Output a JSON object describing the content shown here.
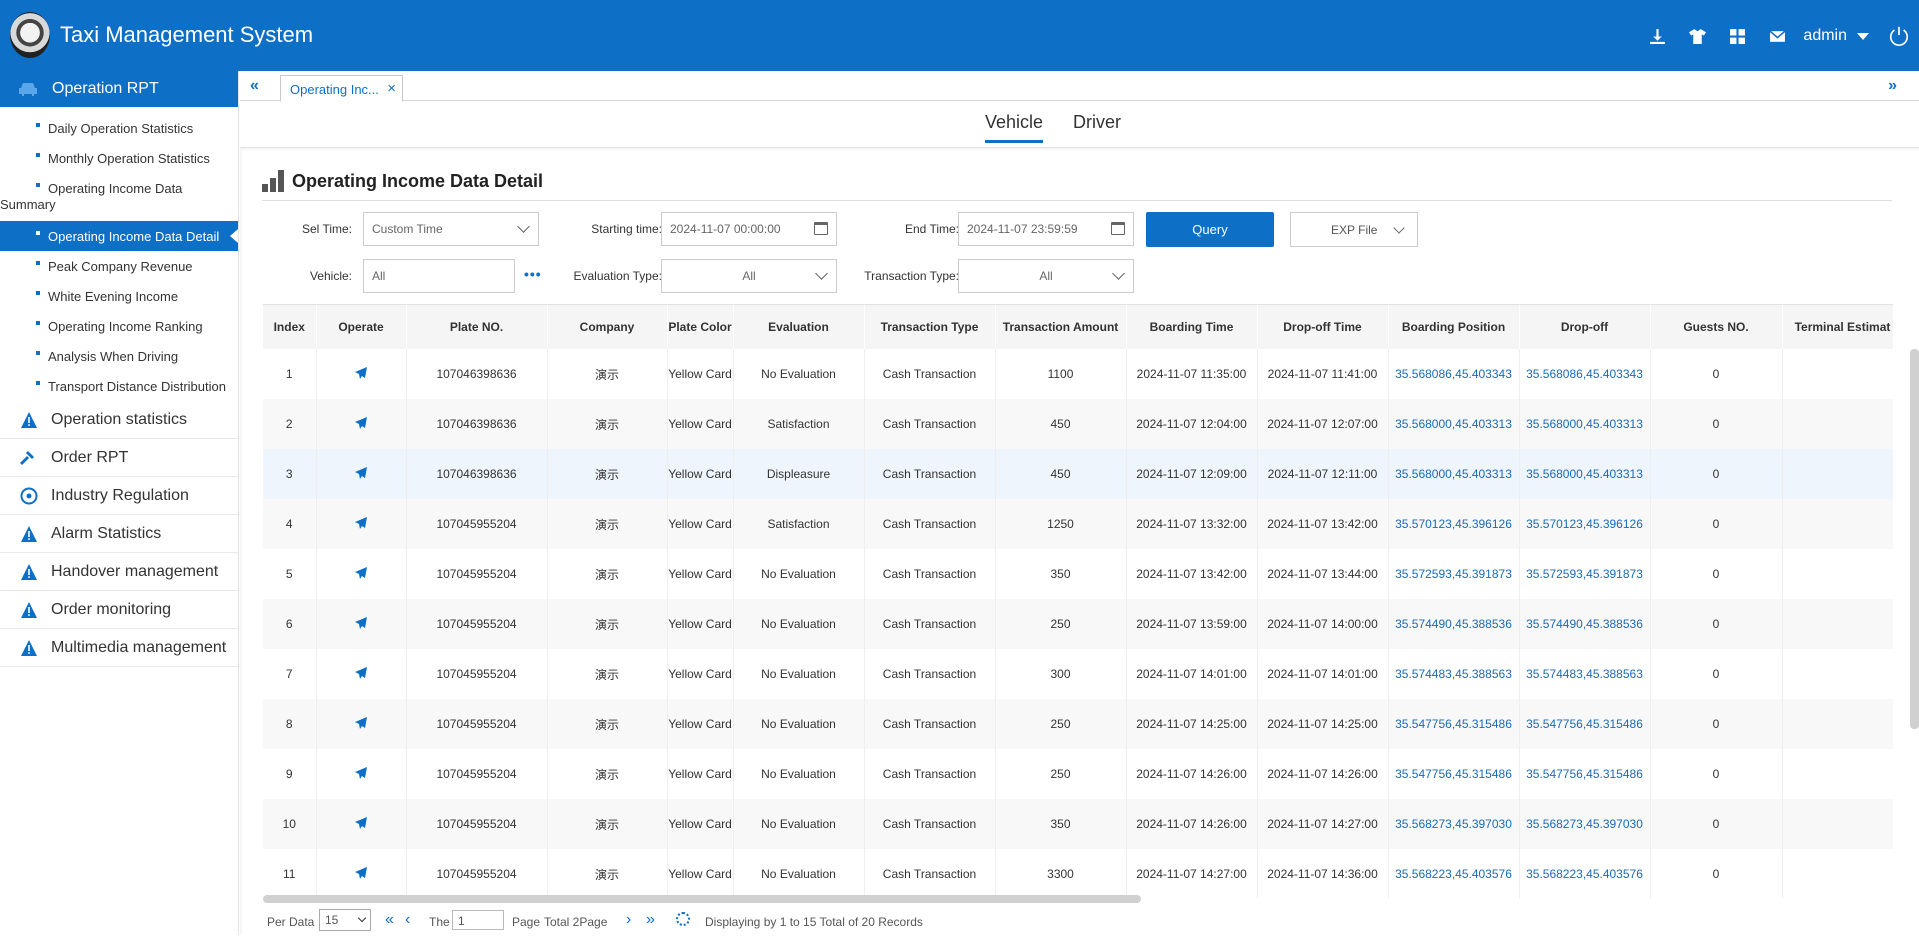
{
  "header": {
    "title": "Taxi Management System",
    "user": "admin",
    "icons": [
      "download-icon",
      "shirt-icon",
      "grid-icon",
      "mail-icon"
    ]
  },
  "sidebar": {
    "active_group": "Operation RPT",
    "subitems": [
      "Daily Operation Statistics",
      "Monthly Operation Statistics",
      "Operating Income Data",
      "Summary",
      "Operating Income Data Detail",
      "Peak Company Revenue",
      "White Evening Income",
      "Operating Income Ranking",
      "Analysis When Driving",
      "Transport Distance Distribution"
    ],
    "groups": [
      "Operation statistics",
      "Order RPT",
      "Industry Regulation",
      "Alarm Statistics",
      "Handover management",
      "Order monitoring",
      "Multimedia management"
    ]
  },
  "tabs": {
    "open_tab": "Operating Inc...",
    "close": "×",
    "collapse_left": "«",
    "collapse_right": "»"
  },
  "subnav": {
    "vehicle": "Vehicle",
    "driver": "Driver"
  },
  "section": {
    "title": "Operating Income Data Detail"
  },
  "filters": {
    "sel_time_label": "Sel Time:",
    "sel_time_value": "Custom Time",
    "start_label": "Starting time:",
    "start_value": "2024-11-07 00:00:00",
    "end_label": "End Time:",
    "end_value": "2024-11-07 23:59:59",
    "query": "Query",
    "export": "EXP File",
    "vehicle_label": "Vehicle:",
    "vehicle_value": "All",
    "more": "•••",
    "eval_label": "Evaluation Type:",
    "eval_value": "All",
    "trans_label": "Transaction Type:",
    "trans_value": "All"
  },
  "table": {
    "columns": [
      "Index",
      "Operate",
      "Plate NO.",
      "Company",
      "Plate Color",
      "Evaluation",
      "Transaction Type",
      "Transaction Amount",
      "Boarding Time",
      "Drop-off Time",
      "Boarding Position",
      "Drop-off",
      "Guests NO.",
      "Terminal Estimat"
    ],
    "rows": [
      [
        "1",
        "107046398636",
        "演示",
        "Yellow Card",
        "No Evaluation",
        "Cash Transaction",
        "1100",
        "2024-11-07 11:35:00",
        "2024-11-07 11:41:00",
        "35.568086,45.403343",
        "35.568086,45.403343",
        "0"
      ],
      [
        "2",
        "107046398636",
        "演示",
        "Yellow Card",
        "Satisfaction",
        "Cash Transaction",
        "450",
        "2024-11-07 12:04:00",
        "2024-11-07 12:07:00",
        "35.568000,45.403313",
        "35.568000,45.403313",
        "0"
      ],
      [
        "3",
        "107046398636",
        "演示",
        "Yellow Card",
        "Displeasure",
        "Cash Transaction",
        "450",
        "2024-11-07 12:09:00",
        "2024-11-07 12:11:00",
        "35.568000,45.403313",
        "35.568000,45.403313",
        "0"
      ],
      [
        "4",
        "107045955204",
        "演示",
        "Yellow Card",
        "Satisfaction",
        "Cash Transaction",
        "1250",
        "2024-11-07 13:32:00",
        "2024-11-07 13:42:00",
        "35.570123,45.396126",
        "35.570123,45.396126",
        "0"
      ],
      [
        "5",
        "107045955204",
        "演示",
        "Yellow Card",
        "No Evaluation",
        "Cash Transaction",
        "350",
        "2024-11-07 13:42:00",
        "2024-11-07 13:44:00",
        "35.572593,45.391873",
        "35.572593,45.391873",
        "0"
      ],
      [
        "6",
        "107045955204",
        "演示",
        "Yellow Card",
        "No Evaluation",
        "Cash Transaction",
        "250",
        "2024-11-07 13:59:00",
        "2024-11-07 14:00:00",
        "35.574490,45.388536",
        "35.574490,45.388536",
        "0"
      ],
      [
        "7",
        "107045955204",
        "演示",
        "Yellow Card",
        "No Evaluation",
        "Cash Transaction",
        "300",
        "2024-11-07 14:01:00",
        "2024-11-07 14:01:00",
        "35.574483,45.388563",
        "35.574483,45.388563",
        "0"
      ],
      [
        "8",
        "107045955204",
        "演示",
        "Yellow Card",
        "No Evaluation",
        "Cash Transaction",
        "250",
        "2024-11-07 14:25:00",
        "2024-11-07 14:25:00",
        "35.547756,45.315486",
        "35.547756,45.315486",
        "0"
      ],
      [
        "9",
        "107045955204",
        "演示",
        "Yellow Card",
        "No Evaluation",
        "Cash Transaction",
        "250",
        "2024-11-07 14:26:00",
        "2024-11-07 14:26:00",
        "35.547756,45.315486",
        "35.547756,45.315486",
        "0"
      ],
      [
        "10",
        "107045955204",
        "演示",
        "Yellow Card",
        "No Evaluation",
        "Cash Transaction",
        "350",
        "2024-11-07 14:26:00",
        "2024-11-07 14:27:00",
        "35.568273,45.397030",
        "35.568273,45.397030",
        "0"
      ],
      [
        "11",
        "107045955204",
        "演示",
        "Yellow Card",
        "No Evaluation",
        "Cash Transaction",
        "3300",
        "2024-11-07 14:27:00",
        "2024-11-07 14:36:00",
        "35.568223,45.403576",
        "35.568223,45.403576",
        "0"
      ]
    ],
    "highlighted_row": 3
  },
  "pager": {
    "per_label": "Per Data",
    "per_value": "15",
    "the": "The",
    "page_value": "1",
    "page_label": "Page",
    "total": "Total 2Page",
    "first": "«",
    "prev": "‹",
    "next": "›",
    "last": "»",
    "display": "Displaying by 1 to 15 Total of 20 Records"
  }
}
